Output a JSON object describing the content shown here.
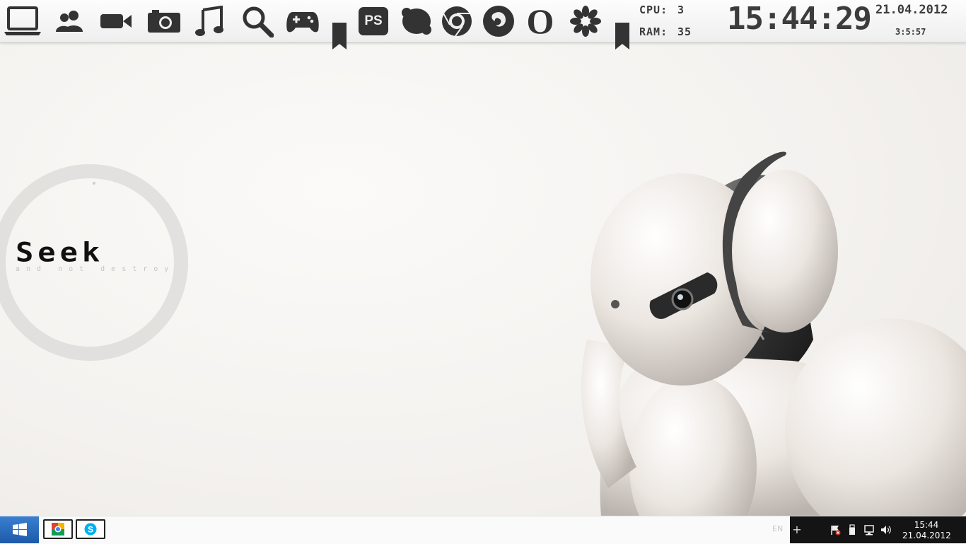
{
  "topbar": {
    "dock": [
      {
        "icon": "laptop-icon"
      },
      {
        "icon": "users-icon"
      },
      {
        "icon": "video-camera-icon"
      },
      {
        "icon": "photo-camera-icon"
      },
      {
        "icon": "music-note-icon"
      },
      {
        "icon": "search-icon"
      },
      {
        "icon": "gamepad-icon"
      },
      {
        "icon": "photoshop-icon",
        "label": "PS"
      },
      {
        "icon": "skype-icon"
      },
      {
        "icon": "chrome-icon"
      },
      {
        "icon": "firefox-icon"
      },
      {
        "icon": "opera-icon",
        "label": "O"
      },
      {
        "icon": "asterisk-icon"
      }
    ],
    "stats": {
      "cpu_label": "CPU:",
      "cpu_value": "3",
      "ram_label": "RAM:",
      "ram_value": "35"
    },
    "clock": {
      "time": "15:44:29",
      "date": "21.04.2012",
      "uptime": "3:5:57"
    }
  },
  "seek_widget": {
    "title": "Seek",
    "subtitle": "and not destroy"
  },
  "taskbar": {
    "pinned": [
      {
        "icon": "chrome-icon"
      },
      {
        "icon": "skype-icon"
      }
    ],
    "language": "EN",
    "tray": {
      "expand_label": "+",
      "time": "15:44",
      "date": "21.04.2012"
    }
  },
  "colors": {
    "icon": "#333333",
    "start": "#2a6cc0",
    "tray": "#141414"
  }
}
